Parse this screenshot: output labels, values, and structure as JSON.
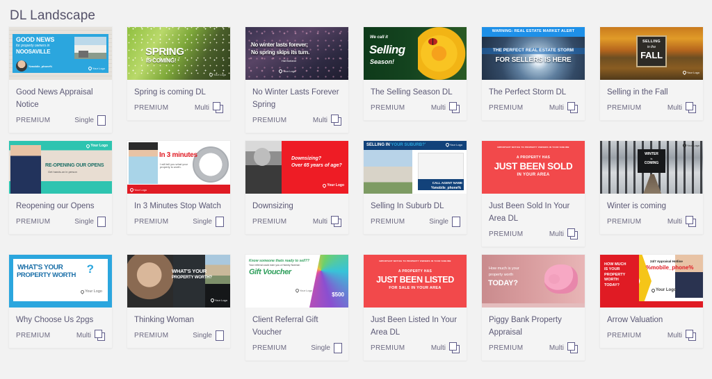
{
  "page": {
    "title": "DL Landscape",
    "background_color": "#f2f2f2",
    "title_color": "#545169",
    "card_background": "#f4f4f4",
    "accent_text_color": "#5a5774"
  },
  "labels": {
    "premium": "PREMIUM",
    "single": "Single",
    "multi": "Multi"
  },
  "cards": [
    {
      "title": "Good News Appraisal Notice",
      "tier": "PREMIUM",
      "pages": "Single",
      "page_icon": "single-page-icon",
      "thumbnail": {
        "name": "good-news-appraisal-thumbnail",
        "headline": "GOOD NEWS",
        "subhead": "for property owners in",
        "suburb": "NOOSAVILLE",
        "phone_token": "%mobile_phone%",
        "logo": "Your Logo",
        "primary_color": "#2ba6de"
      }
    },
    {
      "title": "Spring is coming DL",
      "tier": "PREMIUM",
      "pages": "Multi",
      "page_icon": "multi-page-icon",
      "thumbnail": {
        "name": "spring-is-coming-thumbnail",
        "headline": "SPRING",
        "subhead": "IS COMING!",
        "logo": "Your Logo",
        "primary_color": "#7ea83a"
      }
    },
    {
      "title": "No Winter Lasts Forever Spring",
      "tier": "PREMIUM",
      "pages": "Multi",
      "page_icon": "multi-page-icon",
      "thumbnail": {
        "name": "no-winter-lasts-forever-thumbnail",
        "headline": "No winter lasts forever;",
        "subhead": "No spring skips its turn.",
        "attribution": "Hal Borland",
        "logo": "Your Logo",
        "primary_color": "#3a3350"
      }
    },
    {
      "title": "The Selling Season DL",
      "tier": "PREMIUM",
      "pages": "Multi",
      "page_icon": "multi-page-icon",
      "thumbnail": {
        "name": "the-selling-season-thumbnail",
        "headline": "We call it",
        "subhead": "Selling",
        "extra": "Season!",
        "primary_color": "#14441f"
      }
    },
    {
      "title": "The Perfect Storm DL",
      "tier": "PREMIUM",
      "pages": "Multi",
      "page_icon": "multi-page-icon",
      "thumbnail": {
        "name": "the-perfect-storm-thumbnail",
        "alert": "WARNING: REAL ESTATE MARKET ALERT",
        "headline": "THE PERFECT REAL ESTATE STORM",
        "subhead": "FOR SELLERS IS HERE",
        "primary_color": "#1e90e8"
      }
    },
    {
      "title": "Selling in the Fall",
      "tier": "PREMIUM",
      "pages": "Multi",
      "page_icon": "multi-page-icon",
      "thumbnail": {
        "name": "selling-in-the-fall-thumbnail",
        "headline": "SELLING",
        "subhead": "in the",
        "extra": "FALL",
        "logo": "Your Logo",
        "primary_color": "#b5651d"
      }
    },
    {
      "title": "Reopening our Opens",
      "tier": "PREMIUM",
      "pages": "Single",
      "page_icon": "single-page-icon",
      "thumbnail": {
        "name": "reopening-our-opens-thumbnail",
        "headline": "RE-OPENING OUR OPENS",
        "subhead": "Get hands-on in person",
        "logo": "Your Logo",
        "primary_color": "#2ec4b0"
      }
    },
    {
      "title": "In 3 Minutes Stop Watch",
      "tier": "PREMIUM",
      "pages": "Single",
      "page_icon": "single-page-icon",
      "thumbnail": {
        "name": "in-3-minutes-stop-watch-thumbnail",
        "headline": "In 3 minutes",
        "subhead": "I will tell you what your property is worth.",
        "logo": "Your Logo",
        "primary_color": "#e01b24"
      }
    },
    {
      "title": "Downsizing",
      "tier": "PREMIUM",
      "pages": "Multi",
      "page_icon": "multi-page-icon",
      "thumbnail": {
        "name": "downsizing-thumbnail",
        "headline": "Downsizing?",
        "subhead": "Over 65 years of age?",
        "logo": "Your Logo",
        "primary_color": "#ee1c25"
      }
    },
    {
      "title": "Selling In Suburb DL",
      "tier": "PREMIUM",
      "pages": "Single",
      "page_icon": "single-page-icon",
      "thumbnail": {
        "name": "selling-in-suburb-thumbnail",
        "headline": "SELLING IN",
        "subhead": "'YOUR SUBURB?'",
        "cta": "CALL AGENT NAME",
        "phone_token": "%mobile_phone%",
        "logo": "Your Logo",
        "primary_color": "#12427a"
      }
    },
    {
      "title": "Just Been Sold In Your Area DL",
      "tier": "PREMIUM",
      "pages": "Multi",
      "page_icon": "multi-page-icon",
      "thumbnail": {
        "name": "just-been-sold-thumbnail",
        "eyebrow": "IMPORTANT NOTICE TO PROPERTY OWNERS IN YOUR SUBURB",
        "headline": "JUST BEEN SOLD",
        "subhead": "A PROPERTY HAS",
        "extra": "IN YOUR AREA",
        "primary_color": "#f2494b"
      }
    },
    {
      "title": "Winter is coming",
      "tier": "PREMIUM",
      "pages": "Multi",
      "page_icon": "multi-page-icon",
      "thumbnail": {
        "name": "winter-is-coming-thumbnail",
        "headline": "WINTER",
        "subhead": "is",
        "extra": "COMING",
        "logo": "Your Logo",
        "primary_color": "#9aa1a8"
      }
    },
    {
      "title": "Why Choose Us 2pgs",
      "tier": "PREMIUM",
      "pages": "Multi",
      "page_icon": "multi-page-icon",
      "thumbnail": {
        "name": "why-choose-us-thumbnail",
        "headline": "WHAT'S YOUR",
        "subhead": "PROPERTY WORTH",
        "extra": "?",
        "logo": "Your Logo",
        "primary_color": "#2ba6de"
      }
    },
    {
      "title": "Thinking Woman",
      "tier": "PREMIUM",
      "pages": "Single",
      "page_icon": "single-page-icon",
      "thumbnail": {
        "name": "thinking-woman-thumbnail",
        "headline": "WHAT'S YOUR",
        "subhead": "PROPERTY WORTH?",
        "logo": "Your Logo",
        "primary_color": "#2a2f33"
      }
    },
    {
      "title": "Client Referral Gift Voucher",
      "tier": "PREMIUM",
      "pages": "Single",
      "page_icon": "single-page-icon",
      "thumbnail": {
        "name": "client-referral-gift-voucher-thumbnail",
        "eyebrow": "Know someone thats ready to sell??",
        "headline": "Gift Voucher",
        "subhead": "Your referral could earn you a Harvey Norman",
        "amount": "$500",
        "logo": "Your Logo",
        "primary_color": "#2e9e5b"
      }
    },
    {
      "title": "Just Been Listed In Your Area DL",
      "tier": "PREMIUM",
      "pages": "Multi",
      "page_icon": "multi-page-icon",
      "thumbnail": {
        "name": "just-been-listed-thumbnail",
        "eyebrow": "IMPORTANT NOTICE TO PROPERTY OWNERS IN YOUR SUBURB",
        "headline": "JUST BEEN LISTED",
        "subhead": "A PROPERTY HAS",
        "extra": "FOR SALE IN YOUR AREA",
        "primary_color": "#f2494b"
      }
    },
    {
      "title": "Piggy Bank Property Appraisal",
      "tier": "PREMIUM",
      "pages": "Multi",
      "page_icon": "multi-page-icon",
      "thumbnail": {
        "name": "piggy-bank-property-appraisal-thumbnail",
        "headline": "How much is your",
        "subhead": "property worth",
        "extra": "TODAY?",
        "primary_color": "#d79a9c"
      }
    },
    {
      "title": "Arrow Valuation",
      "tier": "PREMIUM",
      "pages": "Multi",
      "page_icon": "multi-page-icon",
      "thumbnail": {
        "name": "arrow-valuation-thumbnail",
        "headline": "HOW MUCH IS YOUR PROPERTY WORTH TODAY?",
        "eyebrow": "24/7 Appraisal Hotline",
        "phone_token": "%mobile_phone%",
        "logo": "Your Logo",
        "primary_color": "#e01b24"
      }
    }
  ]
}
